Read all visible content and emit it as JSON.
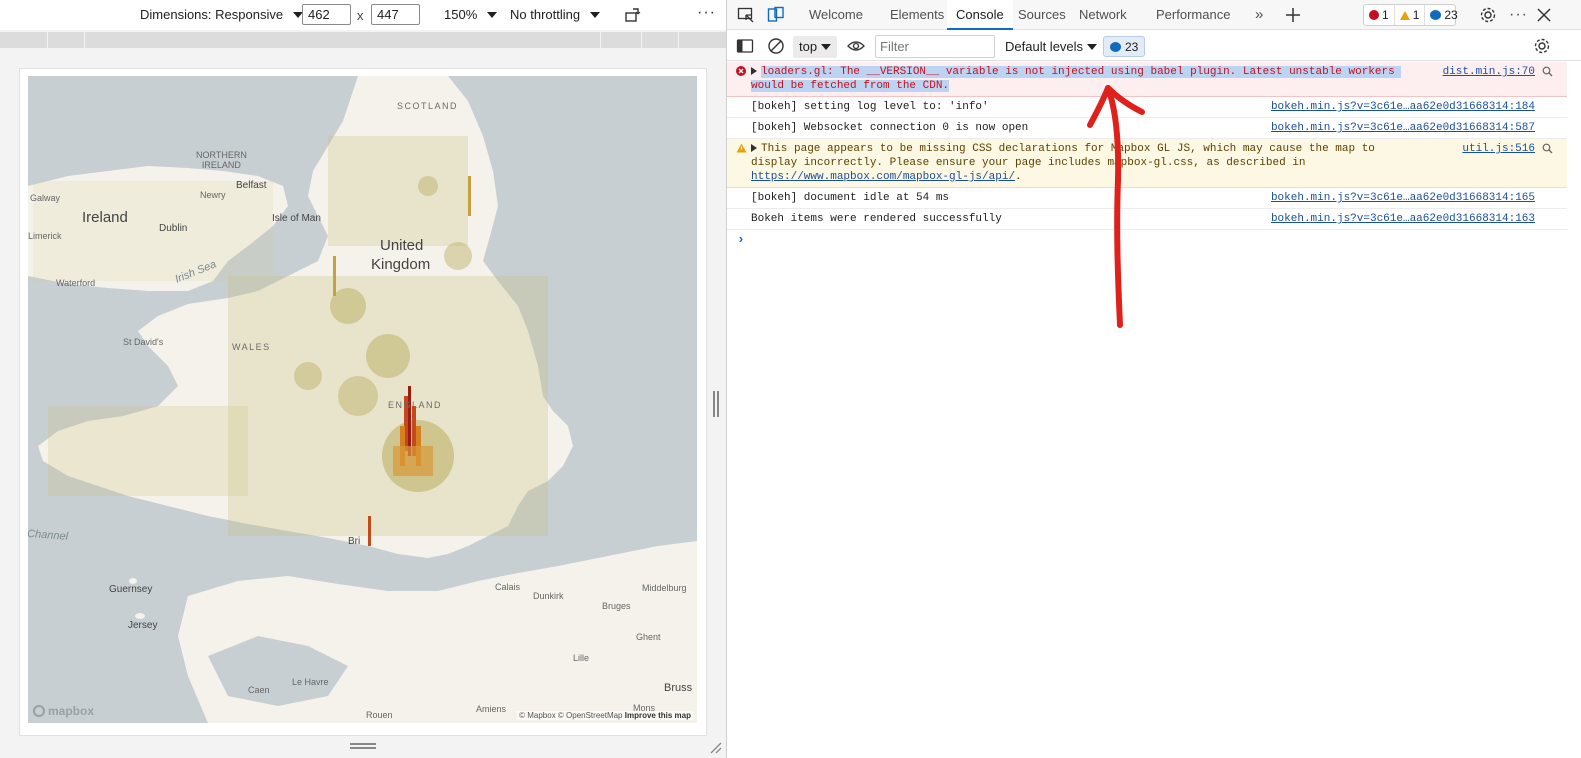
{
  "device_toolbar": {
    "dimensions_label": "Dimensions: Responsive",
    "width_value": "462",
    "height_value": "447",
    "times": "x",
    "zoom": "150%",
    "throttling": "No throttling",
    "more": "⋮"
  },
  "map": {
    "labels": {
      "scotland": "SCOTLAND",
      "northern_ireland": "NORTHERN\nIRELAND",
      "ireland": "Ireland",
      "belfast": "Belfast",
      "newry": "Newry",
      "galway": "Galway",
      "dublin": "Dublin",
      "isle_of_man": "Isle of Man",
      "irish_sea": "Irish Sea",
      "united_kingdom_1": "United",
      "united_kingdom_2": "Kingdom",
      "waterford": "Waterford",
      "wales": "WALES",
      "england": "ENGLAND",
      "st_davids": "St David's",
      "channel": "English Channel",
      "guernsey": "Guernsey",
      "jersey": "Jersey",
      "calais": "Calais",
      "dunkirk": "Dunkirk",
      "middelburg": "Middelburg",
      "bruges": "Bruges",
      "ghent": "Ghent",
      "lille": "Lille",
      "mons": "Mons",
      "caen": "Caen",
      "le_havre": "Le Havre",
      "rouen": "Rouen",
      "amiens": "Amiens",
      "brussels": "Bruss",
      "limerick": "Limerick",
      "bristol": "Bri"
    },
    "logo": "mapbox",
    "attribution": "© Mapbox © OpenStreetMap",
    "improve": "Improve this map"
  },
  "devtools": {
    "tabs": [
      "Welcome",
      "Elements",
      "Console",
      "Sources",
      "Network",
      "Performance"
    ],
    "active_tab": "Console",
    "counts": {
      "errors": "1",
      "warnings": "1",
      "messages": "23"
    },
    "console_toolbar": {
      "context": "top",
      "filter_placeholder": "Filter",
      "levels": "Default levels",
      "issues": "23"
    },
    "messages": [
      {
        "level": "error",
        "text": "loaders.gl: The __VERSION__ variable is not injected using babel plugin. Latest unstable workers would be fetched from the CDN.",
        "source": "dist.min.js:70"
      },
      {
        "level": "info",
        "text": "[bokeh] setting log level to: 'info'",
        "source": "bokeh.min.js?v=3c61e…aa62e0d31668314:184"
      },
      {
        "level": "info",
        "text": "[bokeh] Websocket connection 0 is now open",
        "source": "bokeh.min.js?v=3c61e…aa62e0d31668314:587"
      },
      {
        "level": "warn",
        "text_before_link": "This page appears to be missing CSS declarations for Mapbox GL JS, which may cause the map to display incorrectly. Please ensure your page includes mapbox-gl.css, as described in ",
        "link": "https://www.mapbox.com/mapbox-gl-js/api/",
        "text_after_link": ".",
        "source": "util.js:516"
      },
      {
        "level": "info",
        "text": "[bokeh] document idle at 54 ms",
        "source": "bokeh.min.js?v=3c61e…aa62e0d31668314:165"
      },
      {
        "level": "info",
        "text": "Bokeh items were rendered successfully",
        "source": "bokeh.min.js?v=3c61e…aa62e0d31668314:163"
      }
    ],
    "prompt": "›"
  },
  "colors": {
    "accent": "#0f6cbd",
    "error": "#c50f1f",
    "warning": "#e8a10a",
    "annotation": "#e0201b"
  }
}
